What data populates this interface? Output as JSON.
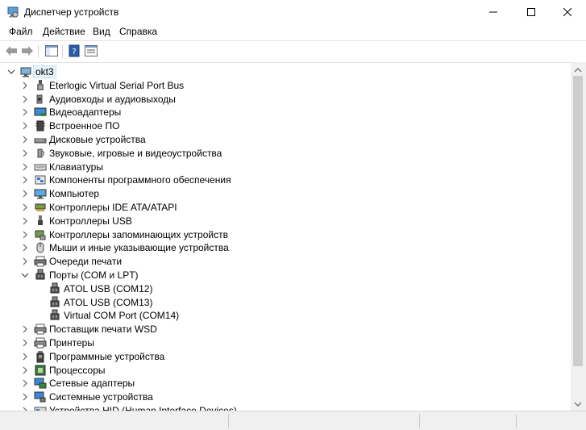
{
  "window": {
    "title": "Диспетчер устройств"
  },
  "menu": [
    "Файл",
    "Действие",
    "Вид",
    "Справка"
  ],
  "tree": {
    "root": "okt3",
    "items": [
      {
        "label": "Eterlogic Virtual Serial Port Bus",
        "icon": "bus-icon",
        "level": 1,
        "expanded": false
      },
      {
        "label": "Аудиовходы и аудиовыходы",
        "icon": "speaker-icon",
        "level": 1,
        "expanded": false
      },
      {
        "label": "Видеоадаптеры",
        "icon": "display-adapter-icon",
        "level": 1,
        "expanded": false
      },
      {
        "label": "Встроенное ПО",
        "icon": "firmware-icon",
        "level": 1,
        "expanded": false
      },
      {
        "label": "Дисковые устройства",
        "icon": "disk-drive-icon",
        "level": 1,
        "expanded": false
      },
      {
        "label": "Звуковые, игровые и видеоустройства",
        "icon": "sound-icon",
        "level": 1,
        "expanded": false
      },
      {
        "label": "Клавиатуры",
        "icon": "keyboard-icon",
        "level": 1,
        "expanded": false
      },
      {
        "label": "Компоненты программного обеспечения",
        "icon": "software-component-icon",
        "level": 1,
        "expanded": false
      },
      {
        "label": "Компьютер",
        "icon": "computer-icon",
        "level": 1,
        "expanded": false
      },
      {
        "label": "Контроллеры IDE ATA/ATAPI",
        "icon": "ide-controller-icon",
        "level": 1,
        "expanded": false
      },
      {
        "label": "Контроллеры USB",
        "icon": "usb-icon",
        "level": 1,
        "expanded": false
      },
      {
        "label": "Контроллеры запоминающих устройств",
        "icon": "storage-controller-icon",
        "level": 1,
        "expanded": false
      },
      {
        "label": "Мыши и иные указывающие устройства",
        "icon": "mouse-icon",
        "level": 1,
        "expanded": false
      },
      {
        "label": "Очереди печати",
        "icon": "print-queue-icon",
        "level": 1,
        "expanded": false
      },
      {
        "label": "Порты (COM и LPT)",
        "icon": "port-icon",
        "level": 1,
        "expanded": true
      },
      {
        "label": "ATOL USB (COM12)",
        "icon": "port-icon",
        "level": 2
      },
      {
        "label": "ATOL USB (COM13)",
        "icon": "port-icon",
        "level": 2
      },
      {
        "label": "Virtual COM Port (COM14)",
        "icon": "port-icon",
        "level": 2
      },
      {
        "label": "Поставщик печати WSD",
        "icon": "printer-icon",
        "level": 1,
        "expanded": false
      },
      {
        "label": "Принтеры",
        "icon": "printer-icon",
        "level": 1,
        "expanded": false
      },
      {
        "label": "Программные устройства",
        "icon": "software-device-icon",
        "level": 1,
        "expanded": false
      },
      {
        "label": "Процессоры",
        "icon": "processor-icon",
        "level": 1,
        "expanded": false
      },
      {
        "label": "Сетевые адаптеры",
        "icon": "network-adapter-icon",
        "level": 1,
        "expanded": false
      },
      {
        "label": "Системные устройства",
        "icon": "system-device-icon",
        "level": 1,
        "expanded": false
      },
      {
        "label": "Устройства HID (Human Interface Devices)",
        "icon": "hid-icon",
        "level": 1,
        "expanded": false
      }
    ]
  },
  "colors": {
    "selection": "#e5f1fb",
    "scrollbar": "#f0f0f0",
    "thumb": "#cdcdcd"
  }
}
